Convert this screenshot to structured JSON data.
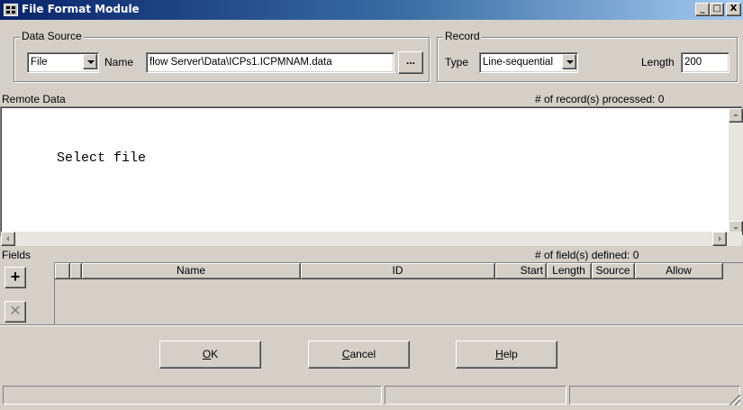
{
  "window": {
    "title": "File Format Module",
    "minimize_label": "_",
    "maximize_label": "□",
    "close_label": "X"
  },
  "data_source": {
    "group_label": "Data Source",
    "type_value": "File",
    "name_label": "Name",
    "name_value": "flow Server\\Data\\ICPs1.ICPMNAM.data",
    "browse_label": "..."
  },
  "record": {
    "group_label": "Record",
    "type_label": "Type",
    "type_value": "Line-sequential",
    "length_label": "Length",
    "length_value": "200"
  },
  "remote_data": {
    "label": "Remote Data",
    "processed_text": "# of record(s) processed: 0",
    "content": "Select file"
  },
  "fields": {
    "label": "Fields",
    "defined_text": "# of field(s) defined:  0",
    "add_label": "+",
    "delete_label": "✕",
    "columns": [
      "Name",
      "ID",
      "Start",
      "Length",
      "Source",
      "Allow"
    ]
  },
  "buttons": {
    "ok": "OK",
    "cancel": "Cancel",
    "help": "Help"
  },
  "colors": {
    "titlebar_start": "#0a246a",
    "titlebar_end": "#a6caf0",
    "face": "#d4d0c8"
  }
}
